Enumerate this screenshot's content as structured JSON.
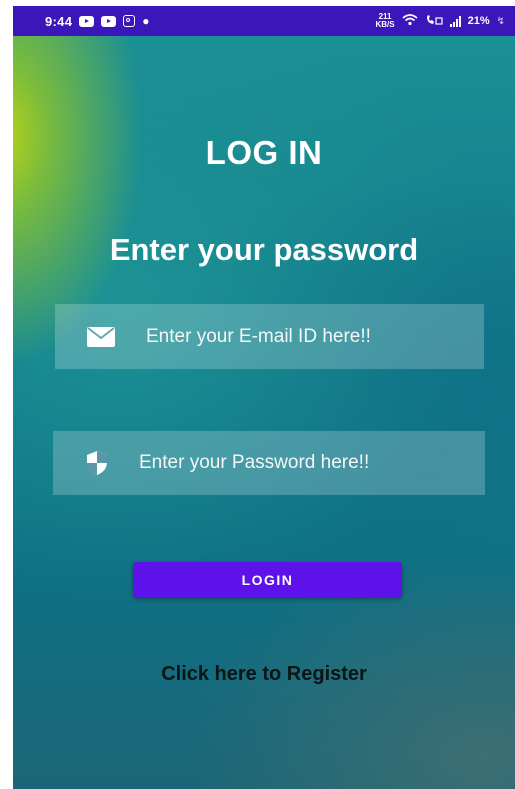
{
  "status_bar": {
    "time": "9:44",
    "left_icons": [
      "youtube-icon",
      "youtube-icon",
      "instagram-icon",
      "app-icon"
    ],
    "network_speed_value": "211",
    "network_speed_unit": "KB/S",
    "battery_percent": "21%",
    "background_color": "#3b16b8"
  },
  "main": {
    "title": "LOG IN",
    "subtitle": "Enter your password",
    "email_field": {
      "icon": "envelope-icon",
      "placeholder": "Enter your E-mail ID here!!"
    },
    "password_field": {
      "icon": "shield-icon",
      "placeholder": "Enter your Password here!!"
    },
    "login_button": {
      "label": "LOGIN",
      "color": "#5d12ea"
    },
    "register_link": "Click here to Register"
  }
}
